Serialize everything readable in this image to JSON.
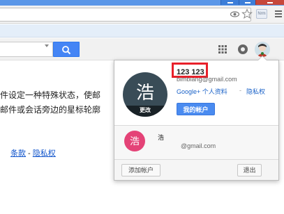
{
  "browser": {
    "extension_label": "Nrm",
    "icons": [
      "eye-icon",
      "star-icon",
      "extension-icon",
      "menu-icon"
    ]
  },
  "header": {
    "search_placeholder": "",
    "search_icon": "search-icon"
  },
  "background_text": {
    "line1": "件设定一种特殊状态，使邮",
    "line2": "邮件或会话旁边的星标轮廓",
    "terms": "条款",
    "separator": " - ",
    "privacy": "隐私权"
  },
  "account_popup": {
    "avatar_char": "浩",
    "avatar_change_label": "更改",
    "user_name": "123 123",
    "user_email": "bimbiang@gmail.com",
    "profile_link": "Google+ 个人资料",
    "dot_separator": "-",
    "privacy_link": "隐私权",
    "my_account_button": "我的帐户",
    "second_account": {
      "avatar_char": "浩",
      "name": "浩",
      "email": "@gmail.com"
    },
    "add_account_button": "添加帐户",
    "sign_out_button": "退出"
  },
  "colors": {
    "accent_blue": "#4a8bf0",
    "highlight_red": "#e8202a",
    "avatar_dark": "#394c57",
    "avatar_pink": "#e44377"
  }
}
